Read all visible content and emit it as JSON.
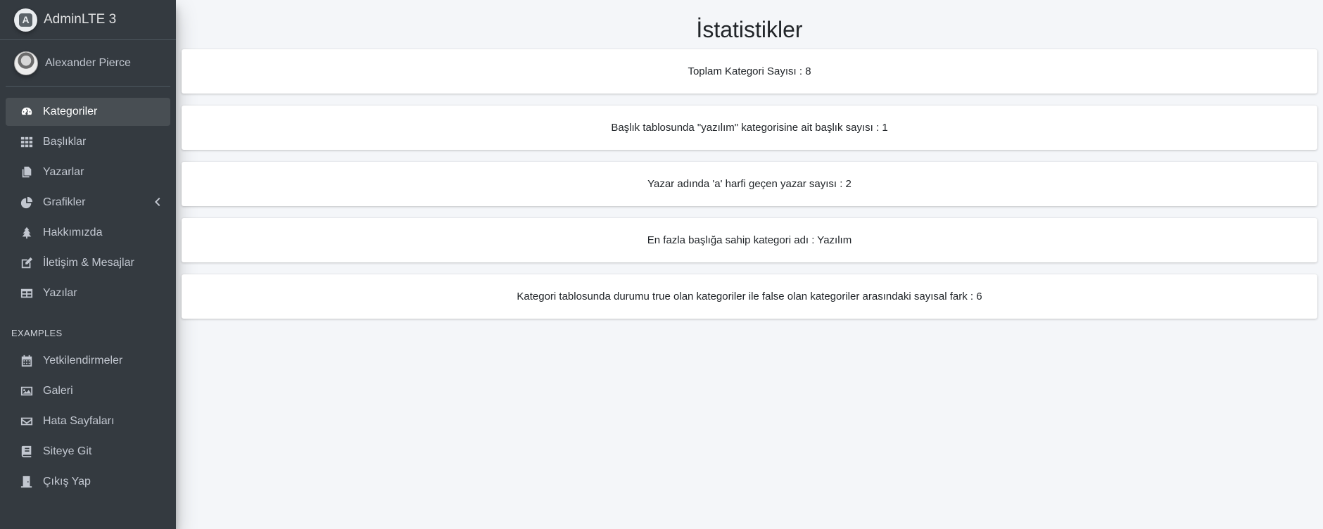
{
  "brand": {
    "name": "AdminLTE 3"
  },
  "user": {
    "name": "Alexander Pierce"
  },
  "nav": [
    {
      "label": "Kategoriler",
      "icon": "tachometer-icon",
      "active": true
    },
    {
      "label": "Başlıklar",
      "icon": "th-icon"
    },
    {
      "label": "Yazarlar",
      "icon": "copy-icon"
    },
    {
      "label": "Grafikler",
      "icon": "chart-pie-icon",
      "has_submenu": true
    },
    {
      "label": "Hakkımızda",
      "icon": "tree-icon"
    },
    {
      "label": "İletişim & Mesajlar",
      "icon": "edit-icon"
    },
    {
      "label": "Yazılar",
      "icon": "table-icon"
    }
  ],
  "nav_header": "EXAMPLES",
  "examples": [
    {
      "label": "Yetkilendirmeler",
      "icon": "calendar-icon"
    },
    {
      "label": "Galeri",
      "icon": "image-icon"
    },
    {
      "label": "Hata Sayfaları",
      "icon": "envelope-icon"
    },
    {
      "label": "Siteye Git",
      "icon": "book-icon"
    },
    {
      "label": "Çıkış Yap",
      "icon": "door-icon"
    }
  ],
  "page": {
    "title": "İstatistikler",
    "stats": [
      "Toplam Kategori Sayısı : 8",
      "Başlık tablosunda \"yazılım\" kategorisine ait başlık sayısı :  1",
      "Yazar adında 'a' harfi geçen yazar sayısı :  2",
      "En fazla başlığa sahip kategori adı :  Yazılım",
      "Kategori tablosunda durumu true olan kategoriler ile false olan kategoriler arasındaki sayısal fark :  6"
    ]
  },
  "colors": {
    "sidebar": "#343a40",
    "background": "#f4f6f9"
  }
}
